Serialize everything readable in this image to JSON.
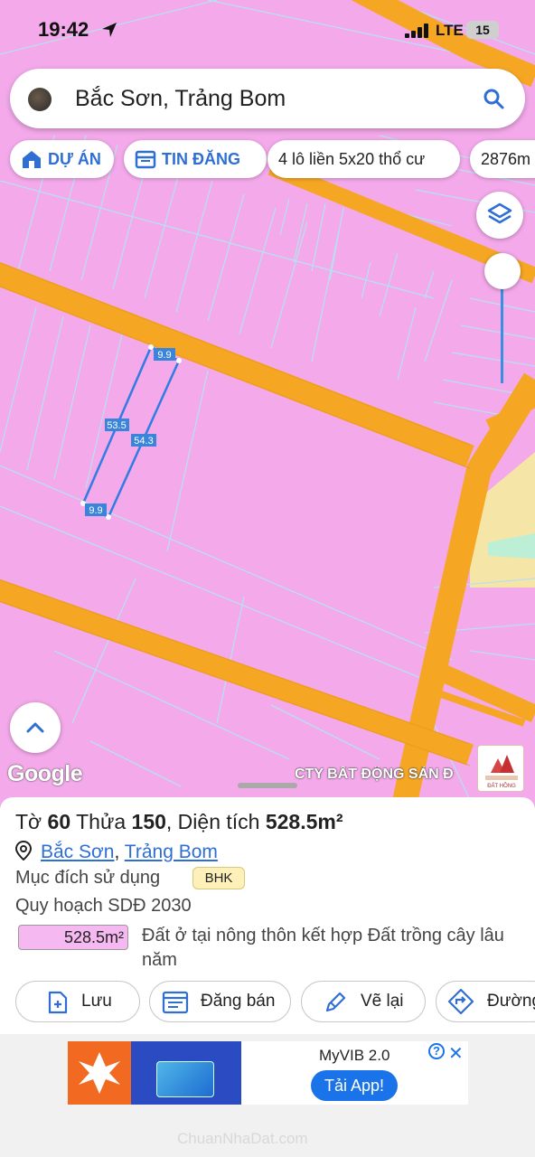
{
  "status": {
    "time": "19:42",
    "network": "LTE",
    "battery": "15"
  },
  "search": {
    "query": "Bắc Sơn, Trảng Bom"
  },
  "chips": [
    {
      "label": "DỰ ÁN",
      "icon": "home-map-icon"
    },
    {
      "label": "TIN ĐĂNG",
      "icon": "listing-icon"
    },
    {
      "label": "4 lô liền 5x20 thổ cư"
    },
    {
      "label": "2876m"
    }
  ],
  "map": {
    "parcel_labels": {
      "top": "9.9",
      "left": "53.5",
      "right": "54.3",
      "bottom": "9.9"
    },
    "google": "Google",
    "watermark": "CTY BẤT ĐỘNG SẢN Đ",
    "logo_caption": "ĐẤT HỒNG",
    "colors": {
      "land": "#f3a9ea",
      "road": "#f5a623",
      "parcel_line": "#2f7de1"
    }
  },
  "sheet": {
    "title_prefix": "Tờ",
    "sheet_no": "60",
    "title_mid": "Thửa",
    "parcel_no": "150",
    "area_label": ", Diện tích",
    "area_value": "528.5m²",
    "address_ward": "Bắc Sơn",
    "address_sep": ",",
    "address_district": "Trảng Bom",
    "purpose_label": "Mục đích sử dụng",
    "purpose_code": "BHK",
    "planning_label": "Quy hoạch SDĐ 2030",
    "planning_area": "528.5m²",
    "planning_desc": "Đất ở tại nông thôn kết hợp Đất trồng cây lâu năm"
  },
  "actions": [
    {
      "label": "Lưu",
      "icon": "save-add-icon"
    },
    {
      "label": "Đăng bán",
      "icon": "post-sale-icon"
    },
    {
      "label": "Vẽ lại",
      "icon": "redraw-icon"
    },
    {
      "label": "Đường",
      "icon": "directions-icon"
    }
  ],
  "ad": {
    "brand": "MyVIB 2.0",
    "cta": "Tải App!",
    "info": "?",
    "close": "✕"
  },
  "bottom_watermark": "ChuanNhaDat.com"
}
